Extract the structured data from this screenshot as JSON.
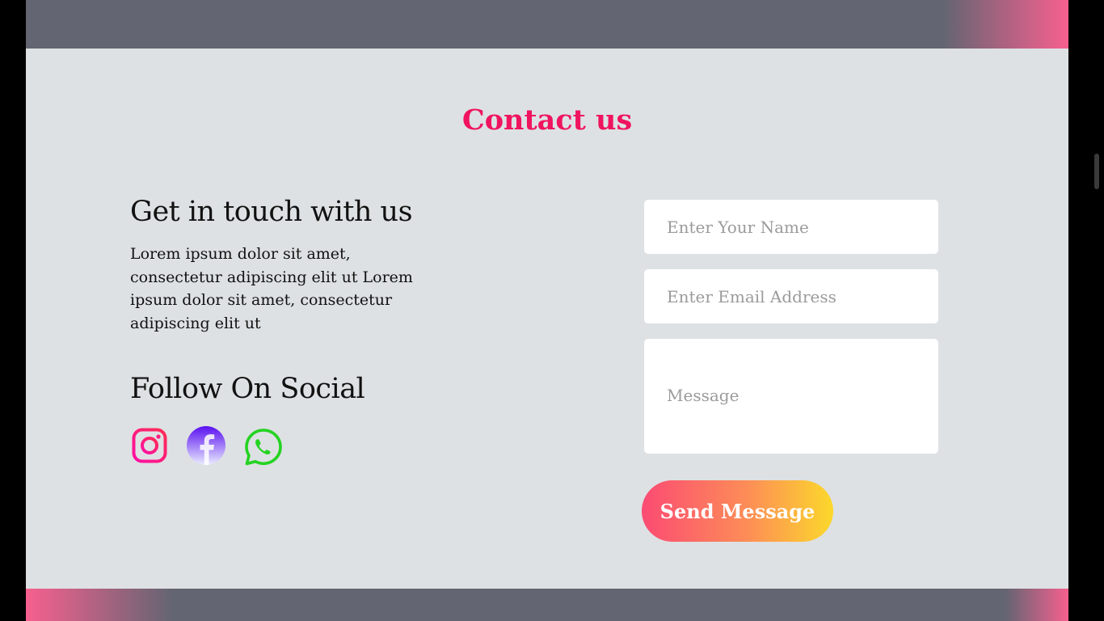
{
  "section": {
    "title": "Contact us"
  },
  "info": {
    "heading": "Get in touch with us",
    "text": "Lorem ipsum dolor sit amet, consectetur adipiscing elit ut Lorem ipsum dolor sit amet, consectetur adipiscing elit ut",
    "social_heading": "Follow On Social",
    "social_icons": [
      "instagram-icon",
      "facebook-icon",
      "whatsapp-icon"
    ]
  },
  "form": {
    "name_placeholder": "Enter Your Name",
    "email_placeholder": "Enter Email Address",
    "message_placeholder": "Message",
    "submit_label": "Send Message"
  },
  "colors": {
    "accent": "#f0145e",
    "background": "#dde1e3",
    "band": "#646572",
    "button_gradient": [
      "#fb4b73",
      "#fcd82b"
    ],
    "whatsapp": "#25d322"
  }
}
